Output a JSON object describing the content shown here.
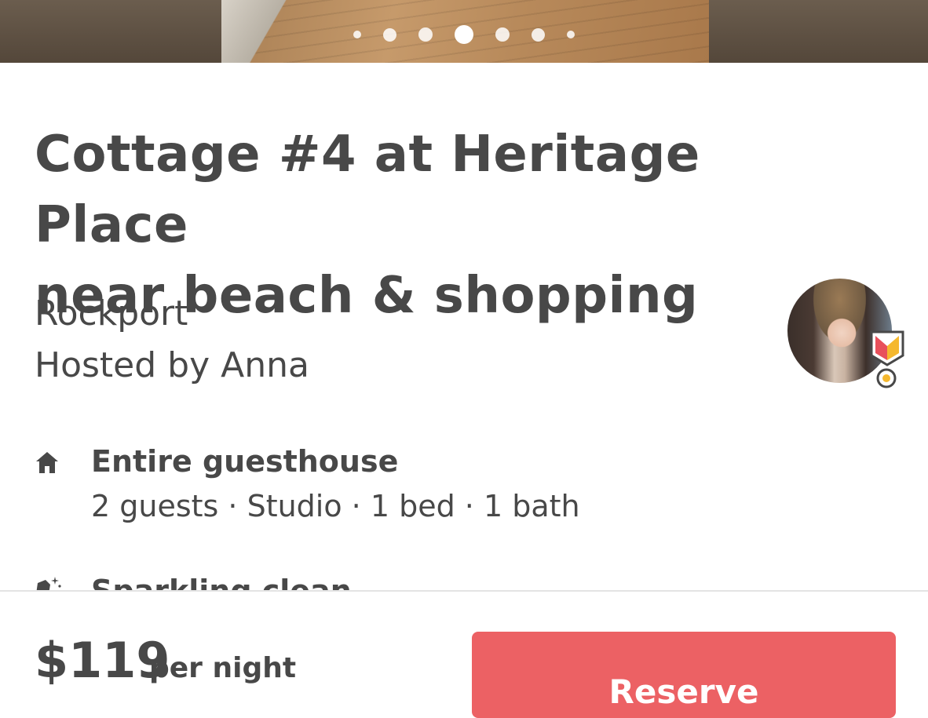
{
  "gallery": {
    "dots": [
      {
        "size": "xs",
        "active": false
      },
      {
        "size": "sm",
        "active": false
      },
      {
        "size": "md",
        "active": false
      },
      {
        "size": "lg",
        "active": true
      },
      {
        "size": "md",
        "active": false
      },
      {
        "size": "sm",
        "active": false
      },
      {
        "size": "xs",
        "active": false
      }
    ]
  },
  "listing": {
    "title_line1": "Cottage #4 at Heritage Place",
    "title_line2": "near beach & shopping",
    "location": "Rockport",
    "host": "Hosted by Anna",
    "host_avatar_icon": "host-avatar",
    "superhost_badge_icon": "superhost-badge-icon"
  },
  "highlights": [
    {
      "icon": "home-icon",
      "title": "Entire guesthouse",
      "subtitle": "2 guests · Studio · 1 bed · 1 bath"
    },
    {
      "icon": "sparkle-clean-icon",
      "title": "Sparkling clean"
    }
  ],
  "footer": {
    "price": "$119",
    "per_night": "per night",
    "reserve_label": "Reserve"
  },
  "colors": {
    "text": "#484848",
    "reserve_button": "#ec6164",
    "badge_red": "#e8505b",
    "badge_yellow": "#f5b82e"
  }
}
